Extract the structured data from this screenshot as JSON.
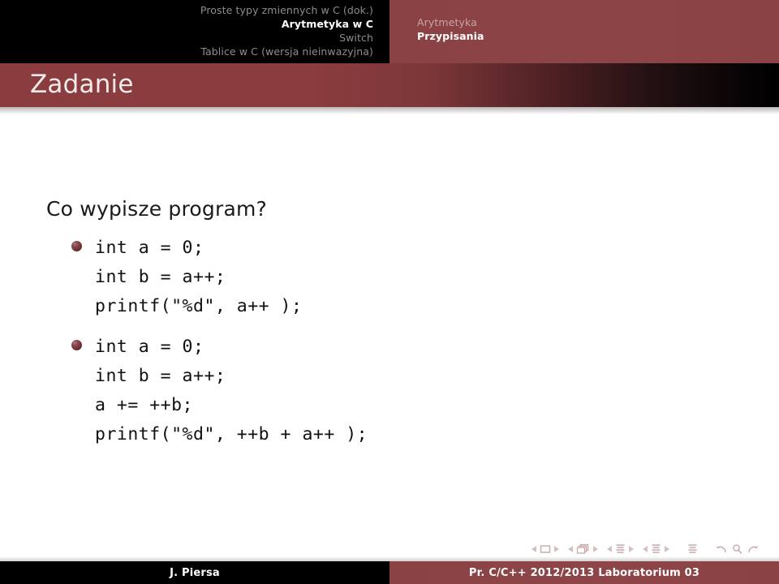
{
  "header": {
    "sections": [
      {
        "label": "Proste typy zmiennych w C (dok.)",
        "active": false
      },
      {
        "label": "Arytmetyka w C",
        "active": true
      },
      {
        "label": "Switch",
        "active": false
      },
      {
        "label": "Tablice w C (wersja nieinwazyjna)",
        "active": false
      }
    ],
    "subsections": [
      {
        "label": "Arytmetyka",
        "active": false
      },
      {
        "label": "Przypisania",
        "active": true
      }
    ]
  },
  "frame": {
    "title": "Zadanie",
    "question": "Co wypisze program?",
    "code_blocks": [
      {
        "lines": [
          "int a = 0;",
          "int b = a++;",
          "printf(\"%d\", a++ );"
        ]
      },
      {
        "lines": [
          "int a = 0;",
          "int b = a++;",
          "a += ++b;",
          "printf(\"%d\", ++b + a++ );"
        ]
      }
    ]
  },
  "navigation": {
    "icons": [
      "prev-slide-icon",
      "slide-icon",
      "next-slide-icon",
      "prev-frame-icon",
      "frame-icon",
      "next-frame-icon",
      "prev-subsection-icon",
      "subsection-icon",
      "next-subsection-icon",
      "prev-section-icon",
      "section-icon",
      "next-section-icon",
      "document-icon",
      "back-icon",
      "find-icon",
      "forward-icon"
    ]
  },
  "footer": {
    "author": "J. Piersa",
    "title": "Pr. C/C++ 2012/2013 Laboratorium 03"
  },
  "colors": {
    "accent_maroon": "#8a4244",
    "title_bar_maroon": "#8a3c3e",
    "black": "#000000",
    "section_inactive": "#8d8d8d",
    "subsection_inactive": "#c9a4a5",
    "bullet": "#713338",
    "nav_symbol": "#c9a9ab"
  }
}
